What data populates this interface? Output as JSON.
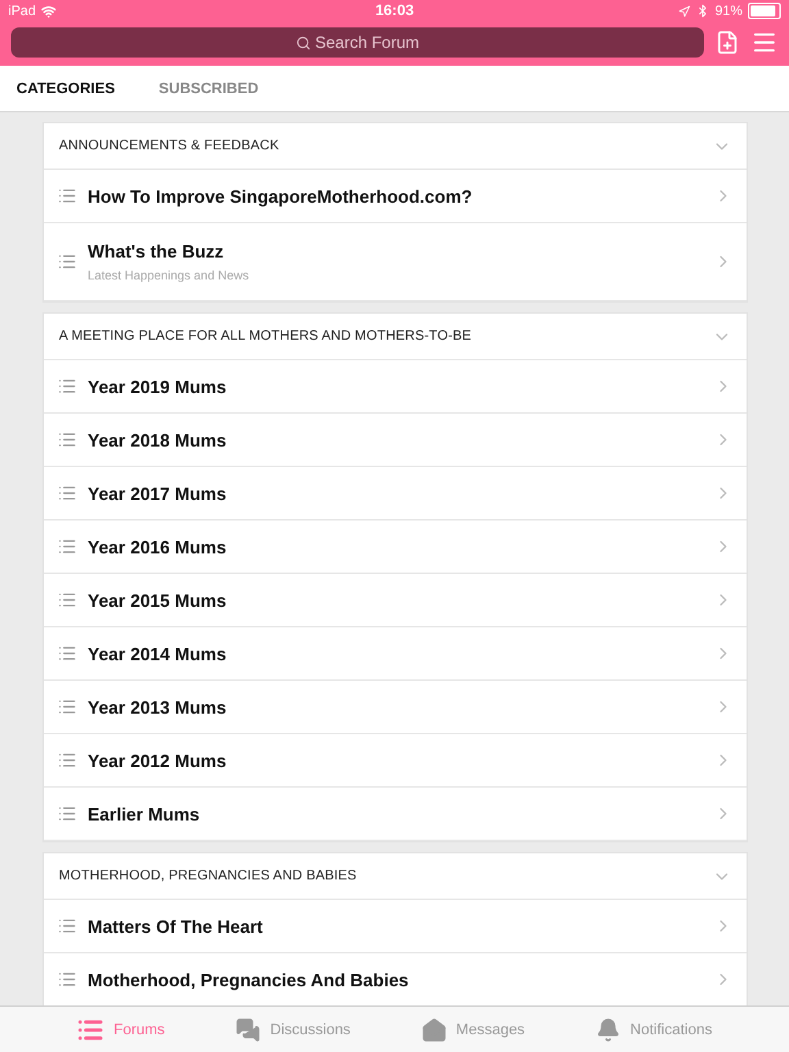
{
  "status_bar": {
    "device": "iPad",
    "time": "16:03",
    "battery": "91%"
  },
  "search": {
    "placeholder": "Search Forum"
  },
  "tabs": [
    {
      "label": "CATEGORIES",
      "selected": true
    },
    {
      "label": "SUBSCRIBED",
      "selected": false
    }
  ],
  "sections": [
    {
      "title": "ANNOUNCEMENTS & FEEDBACK",
      "expanded": true,
      "items": [
        {
          "title": "How To Improve SingaporeMotherhood.com?"
        },
        {
          "title": "What's the Buzz",
          "subtitle": "Latest Happenings and News"
        }
      ]
    },
    {
      "title": "A MEETING PLACE FOR ALL MOTHERS AND MOTHERS-TO-BE",
      "expanded": true,
      "items": [
        {
          "title": "Year 2019 Mums"
        },
        {
          "title": "Year 2018 Mums"
        },
        {
          "title": "Year 2017 Mums"
        },
        {
          "title": "Year 2016 Mums"
        },
        {
          "title": "Year 2015 Mums"
        },
        {
          "title": "Year 2014 Mums"
        },
        {
          "title": "Year 2013 Mums"
        },
        {
          "title": "Year 2012 Mums"
        },
        {
          "title": "Earlier Mums"
        }
      ]
    },
    {
      "title": "MOTHERHOOD, PREGNANCIES AND BABIES",
      "expanded": true,
      "items": [
        {
          "title": "Matters Of The Heart"
        },
        {
          "title": "Motherhood, Pregnancies And Babies"
        }
      ]
    }
  ],
  "bottom_tabs": [
    {
      "label": "Forums",
      "kind": "forums",
      "selected": true
    },
    {
      "label": "Discussions",
      "kind": "discussions",
      "selected": false
    },
    {
      "label": "Messages",
      "kind": "messages",
      "selected": false
    },
    {
      "label": "Notifications",
      "kind": "notifications",
      "selected": false
    }
  ]
}
